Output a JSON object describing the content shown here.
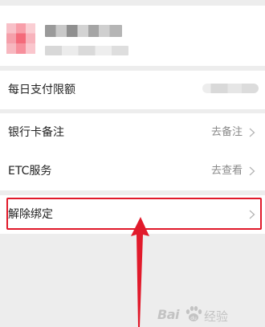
{
  "card": {
    "name_redacted": "",
    "subtitle_redacted": ""
  },
  "rows": {
    "daily_limit": {
      "label": "每日支付限额",
      "value_redacted": ""
    },
    "bank_note": {
      "label": "银行卡备注",
      "value": "去备注"
    },
    "etc": {
      "label": "ETC服务",
      "value": "去查看"
    },
    "unbind": {
      "label": "解除绑定"
    }
  },
  "annotation": {
    "highlight_color": "#e11a2b",
    "arrow_direction": "up"
  },
  "watermark": {
    "brand_latin": "Bai",
    "brand_suffix": "du",
    "brand_cn": "经验"
  },
  "colors": {
    "background": "#ededed",
    "row_bg": "#ffffff",
    "label": "#222222",
    "secondary": "#8a8a8a"
  }
}
